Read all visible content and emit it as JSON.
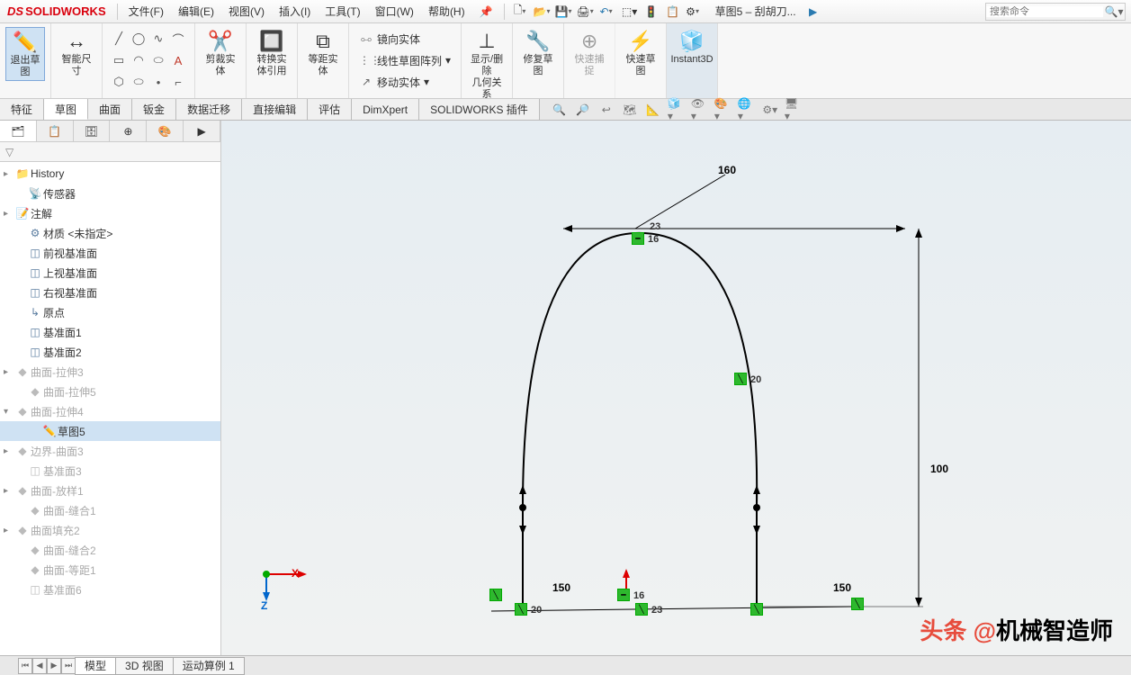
{
  "app": {
    "name": "SOLIDWORKS"
  },
  "menu": {
    "file": "文件(F)",
    "edit": "编辑(E)",
    "view": "视图(V)",
    "insert": "插入(I)",
    "tools": "工具(T)",
    "window": "窗口(W)",
    "help": "帮助(H)"
  },
  "doc_title": "草图5 – 刮胡刀...",
  "search": {
    "placeholder": "搜索命令"
  },
  "ribbon": {
    "exit_sketch": "退出草\n图",
    "smart_dim": "智能尺\n寸",
    "trim": "剪裁实\n体",
    "convert": "转换实\n体引用",
    "offset": "等距实\n体",
    "mirror": "镜向实体",
    "linear_pattern": "线性草图阵列",
    "move": "移动实体",
    "show_delete": "显示/删除\n几何关系",
    "repair": "修复草\n图",
    "quick_snap": "快速捕\n捉",
    "rapid_sketch": "快速草\n图",
    "instant3d": "Instant3D"
  },
  "tabs": {
    "feature": "特征",
    "sketch": "草图",
    "surface": "曲面",
    "sheetmetal": "钣金",
    "migrate": "数据迁移",
    "direct": "直接编辑",
    "evaluate": "评估",
    "dimxpert": "DimXpert",
    "addins": "SOLIDWORKS 插件"
  },
  "tree": {
    "history": "History",
    "sensors": "传感器",
    "annotations": "注解",
    "material": "材质 <未指定>",
    "front": "前视基准面",
    "top": "上视基准面",
    "right": "右视基准面",
    "origin": "原点",
    "plane1": "基准面1",
    "plane2": "基准面2",
    "extrude3": "曲面-拉伸3",
    "extrude5": "曲面-拉伸5",
    "extrude4": "曲面-拉伸4",
    "sketch5": "草图5",
    "boundary3": "边界-曲面3",
    "plane3": "基准面3",
    "loft1": "曲面-放样1",
    "knit1": "曲面-缝合1",
    "fill2": "曲面填充2",
    "knit2": "曲面-缝合2",
    "offset1": "曲面-等距1",
    "plane6": "基准面6"
  },
  "sketch": {
    "dim_top": "160",
    "dim_right": "100",
    "dim_bl": "150",
    "dim_br": "150",
    "rel16a": "16",
    "rel16b": "16",
    "rel20a": "20",
    "rel20b": "20",
    "rel23a": "23",
    "rel23b": "23"
  },
  "bottom_tabs": {
    "model": "模型",
    "view3d": "3D 视图",
    "motion": "运动算例 1"
  },
  "watermark": {
    "prefix": "头条 @",
    "name": "机械智造师"
  },
  "axes": {
    "x": "X",
    "z": "Z"
  }
}
